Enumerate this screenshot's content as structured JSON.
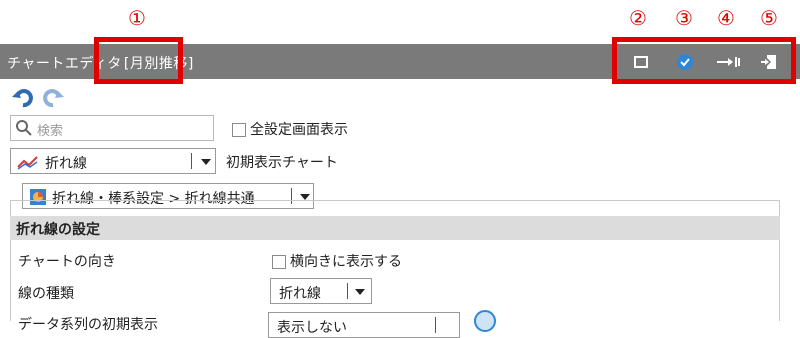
{
  "callouts": [
    "①",
    "②",
    "③",
    "④",
    "⑤"
  ],
  "window": {
    "title": "チャートエディタ",
    "subtitle": "[月別推移]"
  },
  "search": {
    "placeholder": "検索"
  },
  "show_all": {
    "label": "全設定画面表示",
    "checked": false
  },
  "chart_type": {
    "value": "折れ線",
    "label": "初期表示チャート"
  },
  "settings_path": {
    "value": "折れ線・棒系設定 > 折れ線共通"
  },
  "section": {
    "title": "折れ線の設定"
  },
  "rows": [
    {
      "label": "チャートの向き",
      "checkbox_label": "横向きに表示する",
      "checked": false
    },
    {
      "label": "線の種類",
      "select_value": "折れ線"
    }
  ],
  "partial_row": {
    "label": "データ系列の初期表示",
    "select_value": "表示しない"
  },
  "colors": {
    "title_bar": "#7a7a7a",
    "highlight": "#e00000",
    "section_bg": "#dcdcdc",
    "accent": "#2f86d6"
  }
}
